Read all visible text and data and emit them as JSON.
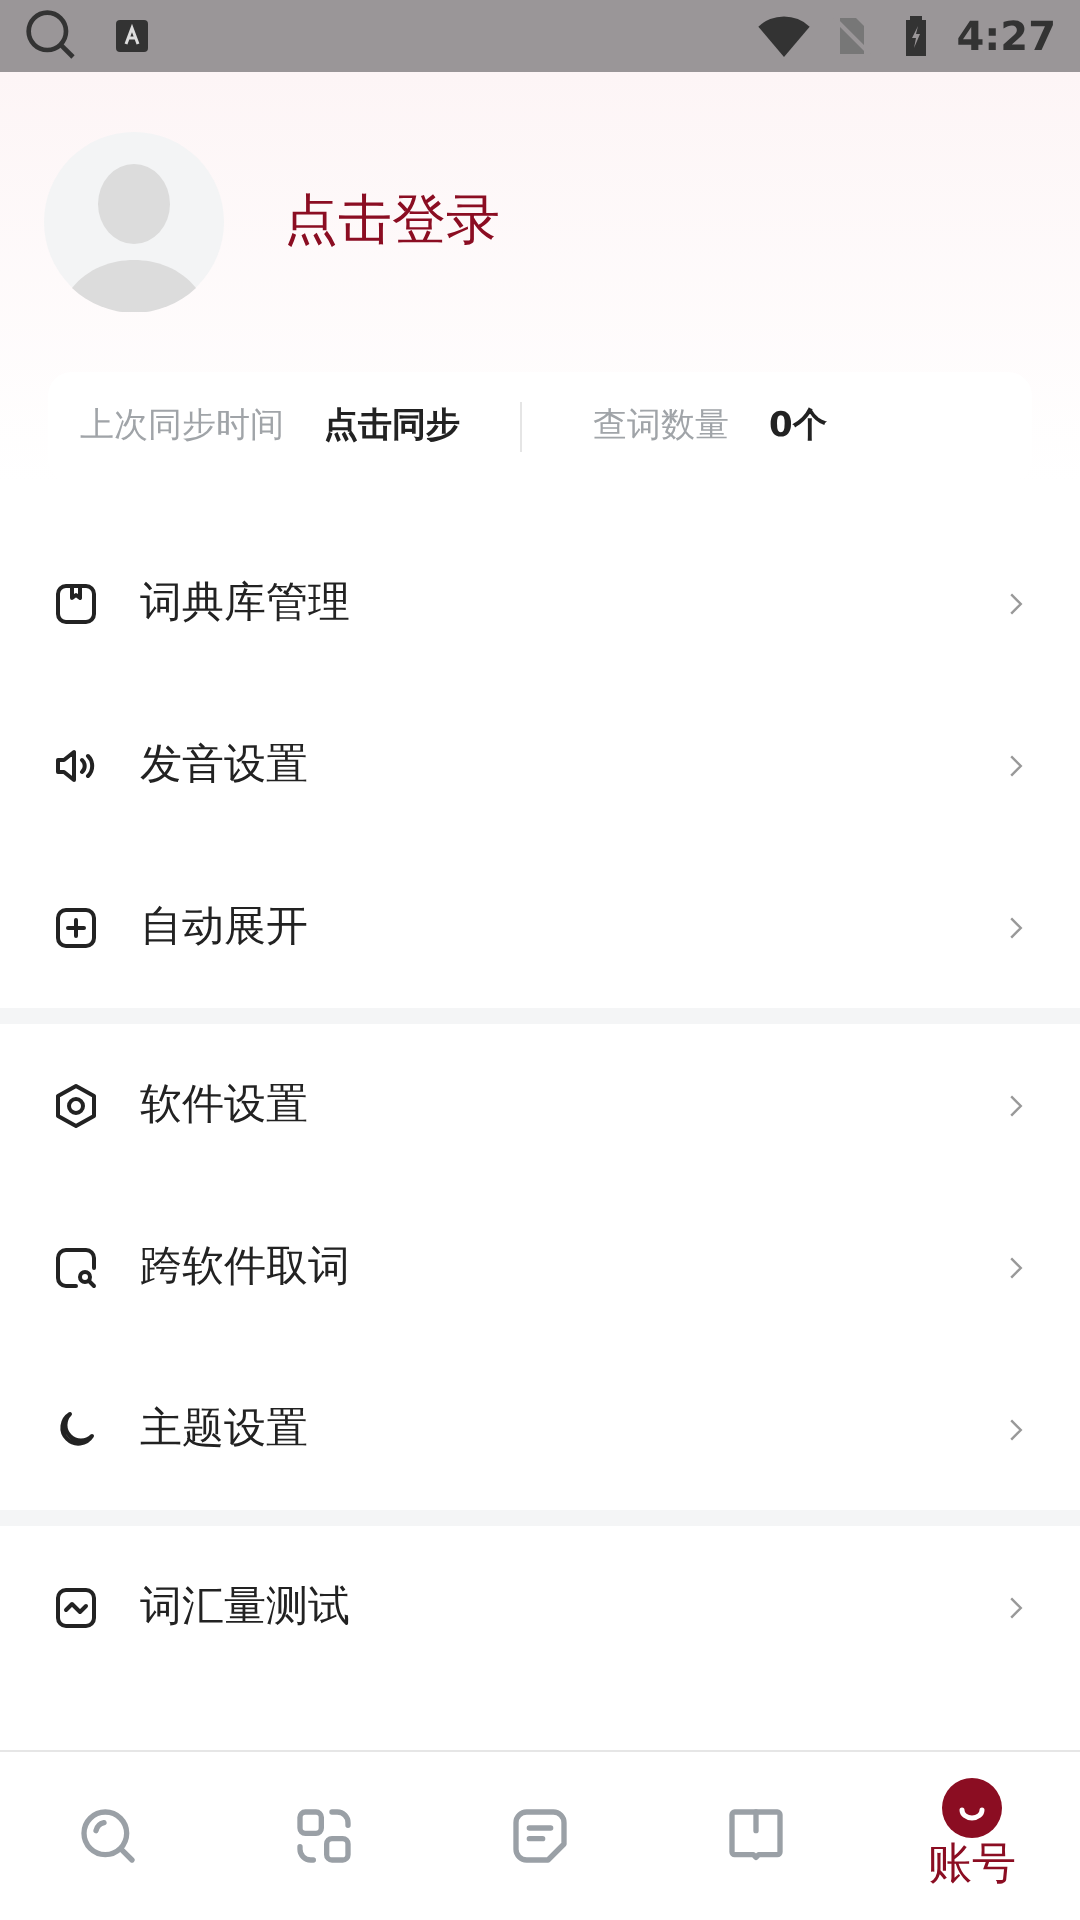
{
  "status_bar": {
    "time": "4:27"
  },
  "profile": {
    "login": "点击登录"
  },
  "stats": [
    {
      "label": "上次同步时间",
      "value": "点击同步"
    },
    {
      "label": "查词数量",
      "value": "0个"
    }
  ],
  "menu_groups": [
    [
      {
        "kind": "book",
        "label": "词典库管理"
      },
      {
        "kind": "speaker",
        "label": "发音设置"
      },
      {
        "kind": "plus",
        "label": "自动展开"
      }
    ],
    [
      {
        "kind": "hexagon",
        "label": "软件设置"
      },
      {
        "kind": "search-square",
        "label": "跨软件取词"
      },
      {
        "kind": "moon",
        "label": "主题设置"
      }
    ],
    [
      {
        "kind": "chart",
        "label": "词汇量测试"
      }
    ]
  ],
  "nav": [
    {
      "kind": "search",
      "selected": false
    },
    {
      "kind": "scan",
      "selected": false
    },
    {
      "kind": "note",
      "selected": false
    },
    {
      "kind": "book",
      "selected": false
    },
    {
      "kind": "account",
      "selected": true,
      "label": "账号"
    }
  ]
}
